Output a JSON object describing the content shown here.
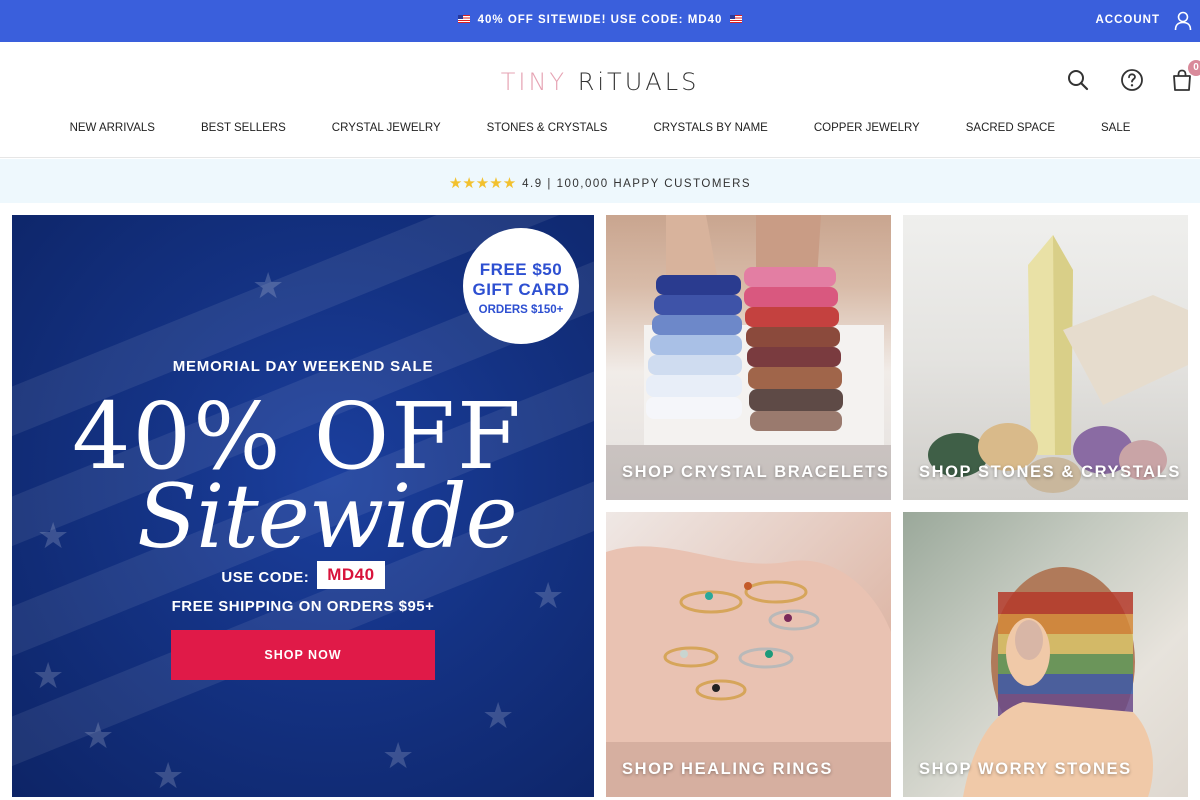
{
  "promo": {
    "text": "40% OFF SITEWIDE! USE CODE: MD40"
  },
  "account": {
    "label": "ACCOUNT"
  },
  "header": {
    "logo_tiny": "TINY",
    "logo_rituals": "RiTUALS",
    "cart_count": "0"
  },
  "nav": {
    "items": [
      "NEW ARRIVALS",
      "BEST SELLERS",
      "CRYSTAL JEWELRY",
      "STONES & CRYSTALS",
      "CRYSTALS BY NAME",
      "COPPER JEWELRY",
      "SACRED SPACE",
      "SALE"
    ]
  },
  "rating": {
    "stars": "★★★★★",
    "score": "4.9",
    "separator": "|",
    "customers": "100,000 HAPPY CUSTOMERS"
  },
  "hero": {
    "gift_line1": "FREE $50",
    "gift_line2": "GIFT CARD",
    "gift_line3": "ORDERS $150+",
    "event": "MEMORIAL DAY WEEKEND SALE",
    "headline": "40% OFF",
    "script": "Sitewide",
    "code_label": "USE CODE:",
    "code": "MD40",
    "shipping": "FREE SHIPPING ON ORDERS $95+",
    "cta": "SHOP NOW"
  },
  "tiles": [
    {
      "label": "SHOP CRYSTAL BRACELETS"
    },
    {
      "label": "SHOP STONES & CRYSTALS"
    },
    {
      "label": "SHOP HEALING RINGS"
    },
    {
      "label": "SHOP WORRY STONES"
    }
  ],
  "colors": {
    "promo_bar": "#3a5fdc",
    "rating_bar": "#eef8fd",
    "hero_blue": "#143283",
    "cta_red": "#e01a48",
    "gift_blue": "#2d4fd1",
    "star_gold": "#f2c12e"
  }
}
